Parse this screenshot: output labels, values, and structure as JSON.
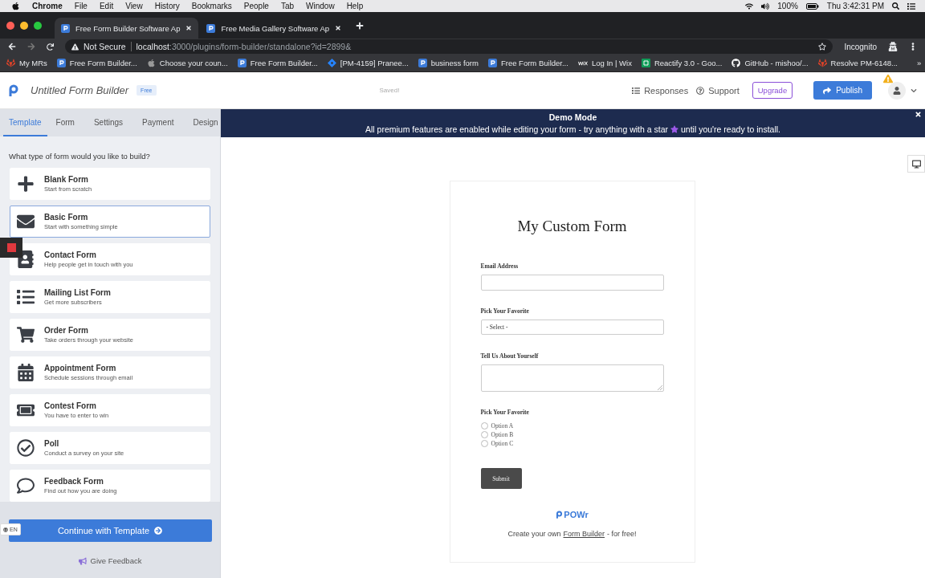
{
  "menubar": {
    "app": "Chrome",
    "menus": [
      "File",
      "Edit",
      "View",
      "History",
      "Bookmarks",
      "People",
      "Tab",
      "Window",
      "Help"
    ],
    "battery": "100%",
    "clock": "Thu 3:42:31 PM"
  },
  "browser": {
    "tabs": [
      {
        "title": "Free Form Builder Software Ap",
        "selected": true
      },
      {
        "title": "Free Media Gallery Software Ap",
        "selected": false
      }
    ],
    "security": "Not Secure",
    "url_host": "localhost",
    "url_path": ":3000/plugins/form-builder/standalone?id=2899&",
    "profile": "Incognito",
    "bookmarks": [
      {
        "label": "My MRs",
        "kind": "gitlab"
      },
      {
        "label": "Free Form Builder...",
        "kind": "powr"
      },
      {
        "label": "Choose your coun...",
        "kind": "apple"
      },
      {
        "label": "Free Form Builder...",
        "kind": "powr"
      },
      {
        "label": "[PM-4159] Pranee...",
        "kind": "jira"
      },
      {
        "label": "business form",
        "kind": "powr"
      },
      {
        "label": "Free Form Builder...",
        "kind": "powr"
      },
      {
        "label": "Log In | Wix",
        "kind": "wix"
      },
      {
        "label": "Reactify 3.0 - Goo...",
        "kind": "sheets"
      },
      {
        "label": "GitHub - mishoo/...",
        "kind": "github"
      },
      {
        "label": "Resolve PM-6148...",
        "kind": "gitlab"
      }
    ],
    "more": "»"
  },
  "app": {
    "title": "Untitled Form Builder",
    "plan_badge": "Free",
    "save_status": "Saved!",
    "nav": [
      {
        "label": "Responses",
        "kind": "list"
      },
      {
        "label": "Support",
        "kind": "help"
      }
    ],
    "upgrade": "Upgrade",
    "publish": "Publish"
  },
  "sidebar": {
    "tabs": [
      {
        "label": "Template",
        "selected": true
      },
      {
        "label": "Form",
        "selected": false
      },
      {
        "label": "Settings",
        "selected": false
      },
      {
        "label": "Payment",
        "selected": false
      },
      {
        "label": "Design",
        "selected": false
      }
    ],
    "prompt": "What type of form would you like to build?",
    "templates": [
      {
        "name": "Blank Form",
        "description": "Start from scratch",
        "kind": "plus",
        "selected": false
      },
      {
        "name": "Basic Form",
        "description": "Start with something simple",
        "kind": "envelope",
        "selected": true
      },
      {
        "name": "Contact Form",
        "description": "Help people get in touch with you",
        "kind": "contact",
        "selected": false
      },
      {
        "name": "Mailing List Form",
        "description": "Get more subscribers",
        "kind": "list",
        "selected": false
      },
      {
        "name": "Order Form",
        "description": "Take orders through your website",
        "kind": "cart",
        "selected": false
      },
      {
        "name": "Appointment Form",
        "description": "Schedule sessions through email",
        "kind": "calendar",
        "selected": false
      },
      {
        "name": "Contest Form",
        "description": "You have to enter to win",
        "kind": "ticket",
        "selected": false
      },
      {
        "name": "Poll",
        "description": "Conduct a survey on your site",
        "kind": "check",
        "selected": false
      },
      {
        "name": "Feedback Form",
        "description": "Find out how you are doing",
        "kind": "comment",
        "selected": false
      }
    ],
    "continue": "Continue with Template",
    "feedback": "Give Feedback",
    "language": "EN"
  },
  "banner": {
    "title": "Demo Mode",
    "text_before": "All premium features are enabled while editing your form - try anything with a star",
    "text_after": "until you're ready to install."
  },
  "form": {
    "title": "My Custom Form",
    "fields": [
      {
        "kind": "text",
        "label": "Email Address"
      },
      {
        "kind": "select",
        "label": "Pick Your Favorite",
        "value": "- Select -"
      },
      {
        "kind": "textarea",
        "label": "Tell Us About Yourself"
      },
      {
        "kind": "radio",
        "label": "Pick Your Favorite",
        "options": [
          {
            "label": "Option A",
            "selected": false
          },
          {
            "label": "Option B",
            "selected": false
          },
          {
            "label": "Option C",
            "selected": false
          }
        ]
      }
    ],
    "submit": "Submit",
    "brand": "POWr",
    "promo_before": "Create your own",
    "promo_link": "Form Builder",
    "promo_after": "- for free!"
  }
}
